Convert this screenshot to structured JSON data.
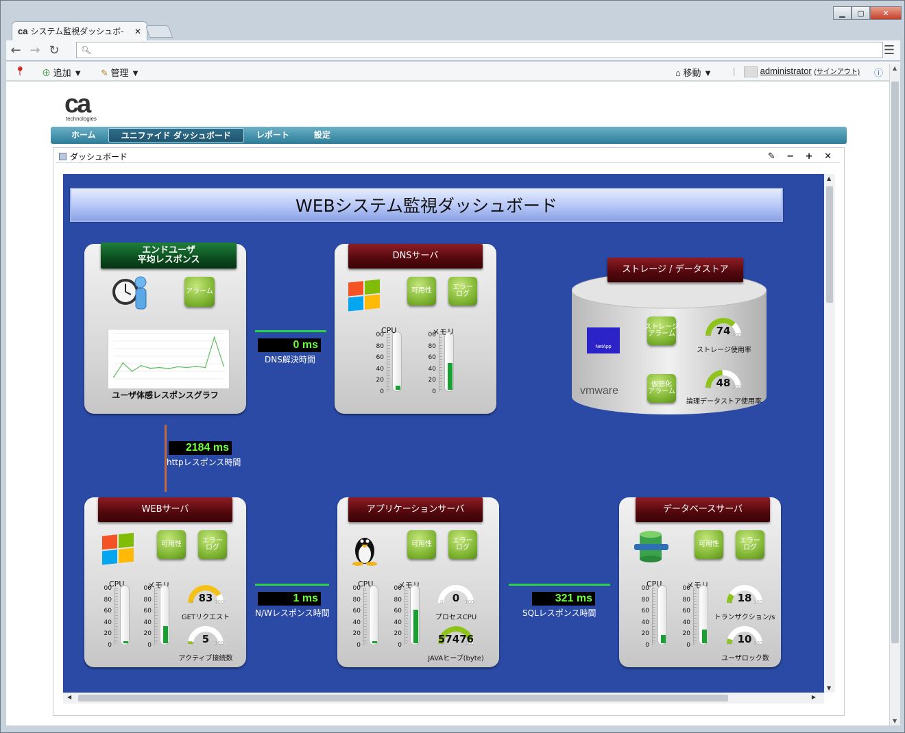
{
  "browser": {
    "tab_title": "システム監視ダッシュボ-",
    "tab_favicon": "ca",
    "url": ""
  },
  "bookmarks": {
    "add_label": "追加 ▼",
    "manage_label": "管理 ▼",
    "move_label": "移動 ▼",
    "user": "administrator",
    "signout": "(サインアウト)"
  },
  "brand": {
    "logo": "ca",
    "sub": "technologies"
  },
  "nav": {
    "items": [
      "ホーム",
      "ユニファイド ダッシュボード",
      "レポート",
      "設定"
    ]
  },
  "portlet": {
    "title": "ダッシュボード",
    "tools": "✎ − + ✕"
  },
  "dashboard": {
    "title": "WEBシステム監視ダッシュボード",
    "enduser": {
      "header": "エンドユーザ\n平均レスポンス",
      "alarm": "アラーム",
      "graph_label": "ユーザ体感レスポンスグラフ",
      "series": [
        5,
        42,
        20,
        35,
        28,
        30,
        27,
        32,
        30,
        33,
        30,
        110,
        35
      ]
    },
    "dns": {
      "header": "DNSサーバ",
      "availability": "可用性",
      "errorlog": "エラー\nログ",
      "cpu_label": "CPU",
      "mem_label": "メモリ",
      "cpu": 0.07,
      "mem": 0.48,
      "ticks_top": "00",
      "ticks": [
        "80",
        "60",
        "40",
        "20",
        "0"
      ]
    },
    "storage": {
      "header": "ストレージ / データストア",
      "netapp": "NetApp",
      "vmware": "vmware",
      "storage_alarm": "ストレージ\nアラーム",
      "virt_alarm": "仮想化\nアラーム",
      "usage_value": "74",
      "usage_label": "ストレージ使用率",
      "logical_value": "48",
      "logical_label": "論理データストア使用率",
      "usage": 0.74,
      "logical": 0.48,
      "min": "0",
      "max": "100"
    },
    "dns_line": {
      "value": "0 ms",
      "label": "DNS解決時間"
    },
    "http_line": {
      "value": "2184 ms",
      "label": "httpレスポンス時間"
    },
    "nw_line": {
      "value": "1 ms",
      "label": "N/Wレスポンス時間"
    },
    "sql_line": {
      "value": "321 ms",
      "label": "SQLレスポンス時間"
    },
    "web": {
      "header": "WEBサーバ",
      "availability": "可用性",
      "errorlog": "エラー\nログ",
      "cpu": 0.04,
      "mem": 0.3,
      "g1_value": "83",
      "g1_label": "GETリクエスト",
      "g1": 0.83,
      "g2_value": "5",
      "g2_label": "アクティブ接続数",
      "g2": 0.05
    },
    "app": {
      "header": "アプリケーションサーバ",
      "availability": "可用性",
      "errorlog": "エラー\nログ",
      "cpu": 0.04,
      "mem": 0.6,
      "g1_value": "0",
      "g1_label": "プロセスCPU",
      "g1": 0.0,
      "g2_value": "57476",
      "g2_label": "JAVAヒープ(byte)",
      "g2": 0.92
    },
    "db": {
      "header": "データベースサーバ",
      "availability": "可用性",
      "errorlog": "エラー\nログ",
      "cpu": 0.15,
      "mem": 0.25,
      "g1_value": "18",
      "g1_label": "トランザクション/s",
      "g1": 0.18,
      "g2_value": "10",
      "g2_label": "ユーザロック数",
      "g2": 0.1
    }
  },
  "colors": {
    "dash_bg": "#2a4aa6",
    "ms_green": "#6cff3c",
    "panel_header": "#52080d"
  }
}
